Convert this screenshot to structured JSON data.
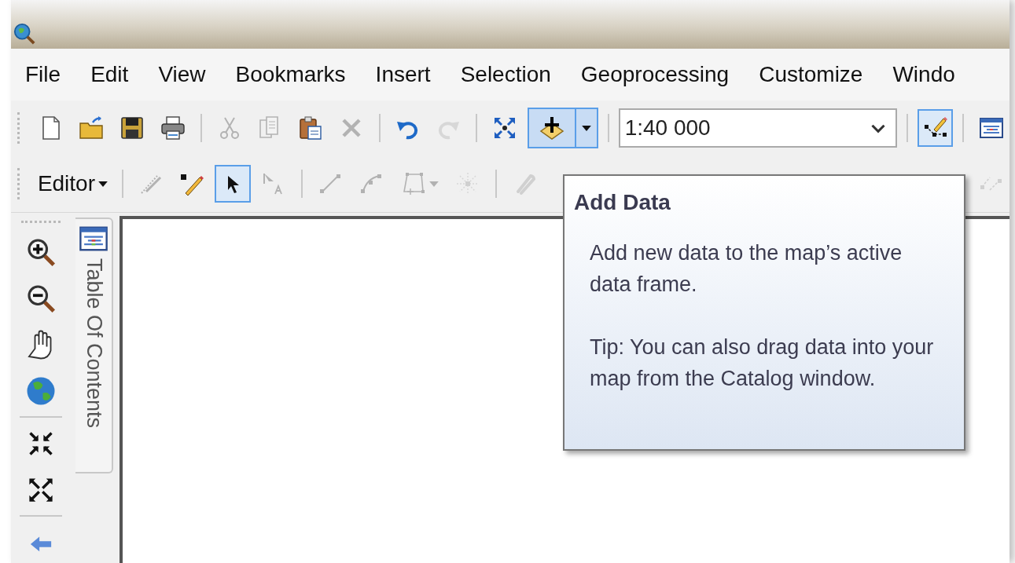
{
  "menu_bar": {
    "items": [
      "File",
      "Edit",
      "View",
      "Bookmarks",
      "Insert",
      "Selection",
      "Geoprocessing",
      "Customize",
      "Windo"
    ]
  },
  "standard_toolbar": {
    "items": [
      {
        "kind": "button",
        "disabled": false,
        "highlighted": false
      },
      {
        "kind": "button",
        "disabled": false,
        "highlighted": false
      },
      {
        "kind": "button",
        "disabled": false,
        "highlighted": false
      },
      {
        "kind": "button",
        "disabled": false,
        "highlighted": false
      },
      {
        "kind": "separator"
      },
      {
        "kind": "button",
        "disabled": true,
        "highlighted": false
      },
      {
        "kind": "button",
        "disabled": true,
        "highlighted": false
      },
      {
        "kind": "button",
        "disabled": false,
        "highlighted": false
      },
      {
        "kind": "button",
        "disabled": true,
        "highlighted": false
      },
      {
        "kind": "separator"
      },
      {
        "kind": "button",
        "disabled": false,
        "highlighted": false
      },
      {
        "kind": "button",
        "disabled": true,
        "highlighted": false
      },
      {
        "kind": "separator"
      },
      {
        "kind": "button",
        "disabled": false,
        "highlighted": false
      },
      {
        "kind": "split",
        "disabled": false,
        "highlighted": true
      },
      {
        "kind": "separator"
      },
      {
        "kind": "combo",
        "value": "1:40 000"
      },
      {
        "kind": "separator"
      },
      {
        "kind": "button",
        "disabled": false,
        "highlighted": true
      },
      {
        "kind": "separator"
      },
      {
        "kind": "button",
        "disabled": false,
        "highlighted": false
      }
    ]
  },
  "editor_toolbar": {
    "menu": "Editor",
    "items": [
      {
        "kind": "separator"
      },
      {
        "kind": "button",
        "disabled": true,
        "selected": false
      },
      {
        "kind": "button",
        "disabled": false,
        "selected": false
      },
      {
        "kind": "button",
        "disabled": false,
        "selected": true
      },
      {
        "kind": "button",
        "disabled": true,
        "selected": false
      },
      {
        "kind": "separator"
      },
      {
        "kind": "button",
        "disabled": true,
        "selected": false
      },
      {
        "kind": "button",
        "disabled": true,
        "selected": false
      },
      {
        "kind": "split",
        "disabled": true,
        "selected": false
      },
      {
        "kind": "button",
        "disabled": true,
        "selected": false
      },
      {
        "kind": "separator"
      },
      {
        "kind": "button",
        "disabled": true,
        "selected": false
      },
      {
        "kind": "gap"
      },
      {
        "kind": "button",
        "disabled": true,
        "selected": false
      }
    ]
  },
  "tools_toolbar": {
    "items": [
      {
        "kind": "button"
      },
      {
        "kind": "button"
      },
      {
        "kind": "button"
      },
      {
        "kind": "button"
      },
      {
        "kind": "separator"
      },
      {
        "kind": "button"
      },
      {
        "kind": "button"
      },
      {
        "kind": "separator"
      },
      {
        "kind": "button"
      }
    ]
  },
  "side_tab": {
    "label": "Table Of Contents"
  },
  "tooltip": {
    "title": "Add Data",
    "paragraphs": [
      "Add new data to the map’s active data frame.",
      "Tip: You can also drag data into your map from the Catalog window."
    ]
  }
}
